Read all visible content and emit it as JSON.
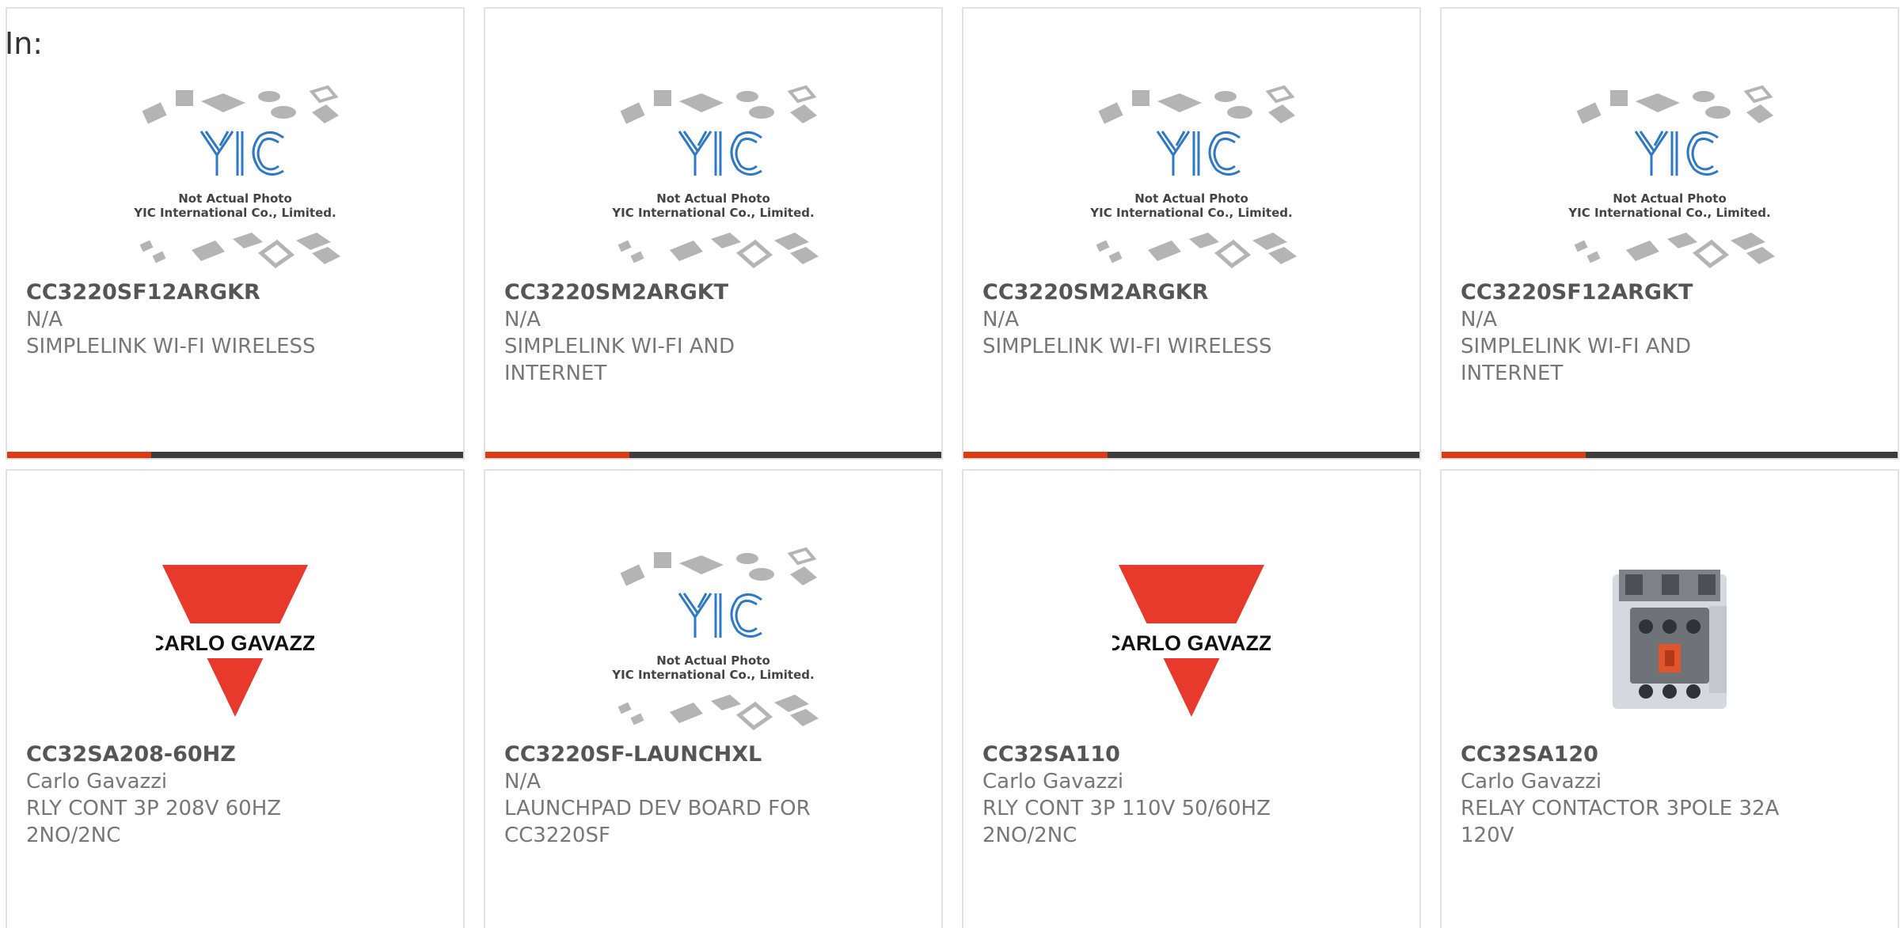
{
  "header": {
    "filter_label": "In:"
  },
  "placeholder_photo": {
    "logo_text": "YIC",
    "caption_line1": "Not Actual Photo",
    "caption_line2": "YIC International Co., Limited."
  },
  "brand_logo_text": "CARLO GAVAZZI",
  "colors": {
    "accent": "#e03a13",
    "bar": "#3d3d3d",
    "brand_red": "#e8392d"
  },
  "products": [
    {
      "part_number": "CC3220SF12ARGKR",
      "manufacturer": "N/A",
      "description": "SIMPLELINK WI-FI WIRELESS",
      "image": "placeholder"
    },
    {
      "part_number": "CC3220SM2ARGKT",
      "manufacturer": "N/A",
      "description": "SIMPLELINK WI-FI AND INTERNET",
      "image": "placeholder"
    },
    {
      "part_number": "CC3220SM2ARGKR",
      "manufacturer": "N/A",
      "description": "SIMPLELINK WI-FI WIRELESS",
      "image": "placeholder"
    },
    {
      "part_number": "CC3220SF12ARGKT",
      "manufacturer": "N/A",
      "description": "SIMPLELINK WI-FI AND INTERNET",
      "image": "placeholder"
    },
    {
      "part_number": "CC32SA208-60HZ",
      "manufacturer": "Carlo Gavazzi",
      "description": "RLY CONT 3P 208V 60HZ 2NO/2NC",
      "image": "brand-logo"
    },
    {
      "part_number": "CC3220SF-LAUNCHXL",
      "manufacturer": "N/A",
      "description": "LAUNCHPAD DEV BOARD FOR CC3220SF",
      "image": "placeholder"
    },
    {
      "part_number": "CC32SA110",
      "manufacturer": "Carlo Gavazzi",
      "description": "RLY CONT 3P 110V 50/60HZ 2NO/2NC",
      "image": "brand-logo"
    },
    {
      "part_number": "CC32SA120",
      "manufacturer": "Carlo Gavazzi",
      "description": "RELAY CONTACTOR 3POLE 32A 120V",
      "image": "contactor-photo"
    }
  ]
}
